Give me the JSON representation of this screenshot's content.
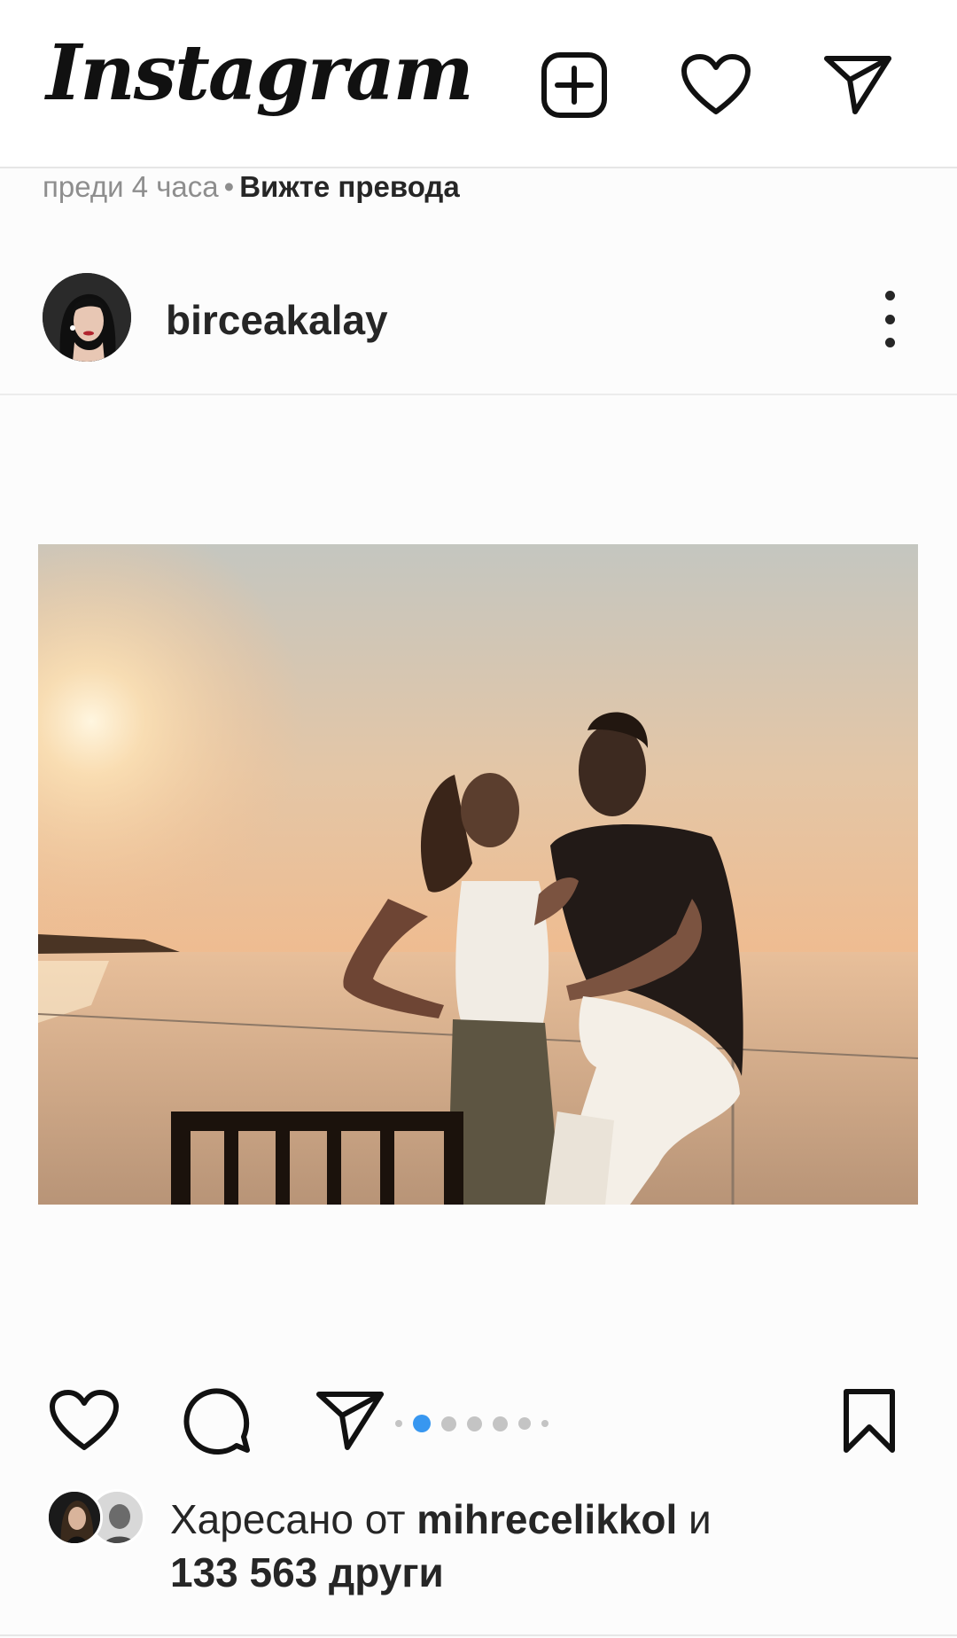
{
  "app": {
    "logo_text": "Instagram",
    "icons": {
      "create": "plus-square-icon",
      "activity": "heart-icon",
      "direct": "paper-plane-icon"
    }
  },
  "previous_post": {
    "time_ago": "преди 4 часа",
    "separator": "•",
    "translate_link": "Вижте превода"
  },
  "post": {
    "username": "birceakalay",
    "more_icon": "more-vertical-icon",
    "carousel": {
      "total": 6,
      "active_index": 1,
      "active_color": "#3897f0"
    },
    "actions": {
      "like": "heart-icon",
      "comment": "comment-icon",
      "share": "paper-plane-icon",
      "save": "bookmark-icon"
    },
    "likes": {
      "prefix": "Харесано от ",
      "user": "mihrecelikkol",
      "connector": " и",
      "count": "133 563 други"
    }
  }
}
